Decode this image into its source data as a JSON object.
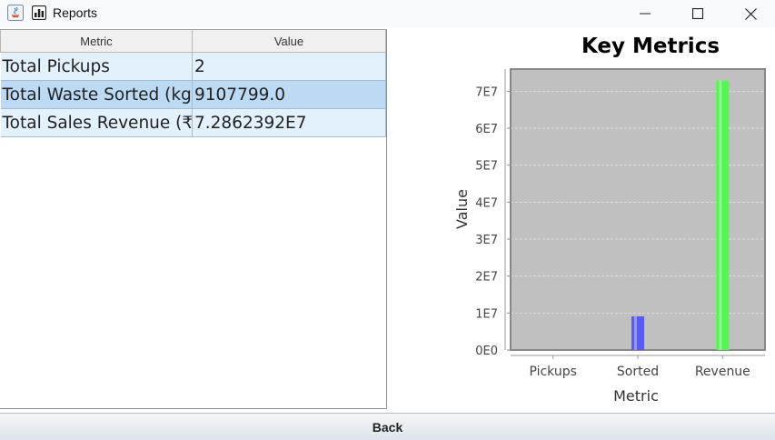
{
  "window": {
    "title": "Reports",
    "controls": [
      "minimize",
      "maximize",
      "close"
    ]
  },
  "table": {
    "headers": [
      "Metric",
      "Value"
    ],
    "rows": [
      {
        "metric": "Total Pickups",
        "value": "2"
      },
      {
        "metric": "Total Waste Sorted (kg)",
        "value": "9107799.0"
      },
      {
        "metric": "Total Sales Revenue (₹)",
        "value": "7.2862392E7"
      }
    ],
    "selected_row": 1
  },
  "chart_data": {
    "type": "bar",
    "title": "Key Metrics",
    "xlabel": "Metric",
    "ylabel": "Value",
    "categories": [
      "Pickups",
      "Sorted",
      "Revenue"
    ],
    "values": [
      2,
      9107799.0,
      72862392
    ],
    "colors": [
      "#5a5af5",
      "#5a5af5",
      "#55f555"
    ],
    "ylim": [
      0,
      76000000
    ],
    "yticks": [
      0,
      10000000,
      20000000,
      30000000,
      40000000,
      50000000,
      60000000,
      70000000
    ],
    "ytick_labels": [
      "0E0",
      "1E7",
      "2E7",
      "3E7",
      "4E7",
      "5E7",
      "6E7",
      "7E7"
    ],
    "grid": true,
    "plot_background": "#c0c0c0"
  },
  "footer": {
    "back_label": "Back"
  }
}
